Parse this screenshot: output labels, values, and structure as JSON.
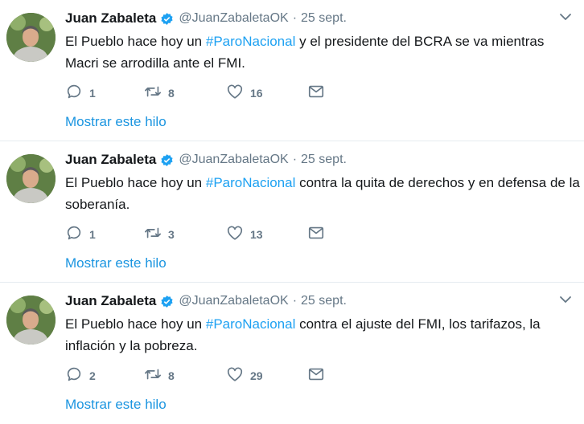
{
  "tweets": [
    {
      "author": "Juan Zabaleta",
      "handle": "@JuanZabaletaOK",
      "separator": "·",
      "date": "25 sept.",
      "text_before": "El Pueblo hace hoy un ",
      "hashtag": "#ParoNacional",
      "text_after": " y el presidente del BCRA se va mientras Macri se arrodilla ante el FMI.",
      "replies": "1",
      "retweets": "8",
      "likes": "16",
      "show_thread": "Mostrar este hilo"
    },
    {
      "author": "Juan Zabaleta",
      "handle": "@JuanZabaletaOK",
      "separator": "·",
      "date": "25 sept.",
      "text_before": "El Pueblo hace hoy un ",
      "hashtag": "#ParoNacional",
      "text_after": " contra la quita de derechos y en defensa de la soberanía.",
      "replies": "1",
      "retweets": "3",
      "likes": "13",
      "show_thread": "Mostrar este hilo"
    },
    {
      "author": "Juan Zabaleta",
      "handle": "@JuanZabaletaOK",
      "separator": "·",
      "date": "25 sept.",
      "text_before": "El Pueblo hace hoy un ",
      "hashtag": "#ParoNacional",
      "text_after": " contra el ajuste del FMI, los tarifazos, la inflación y la pobreza.",
      "replies": "2",
      "retweets": "8",
      "likes": "29",
      "show_thread": "Mostrar este hilo"
    }
  ],
  "icons": {
    "reply": "reply-icon",
    "retweet": "retweet-icon",
    "like": "heart-icon",
    "dm": "envelope-icon",
    "menu": "chevron-down-icon",
    "verified": "verified-badge-icon"
  },
  "colors": {
    "link": "#1b95e0",
    "hashtag": "#1da1f2",
    "muted": "#657786",
    "verified": "#1da1f2"
  }
}
